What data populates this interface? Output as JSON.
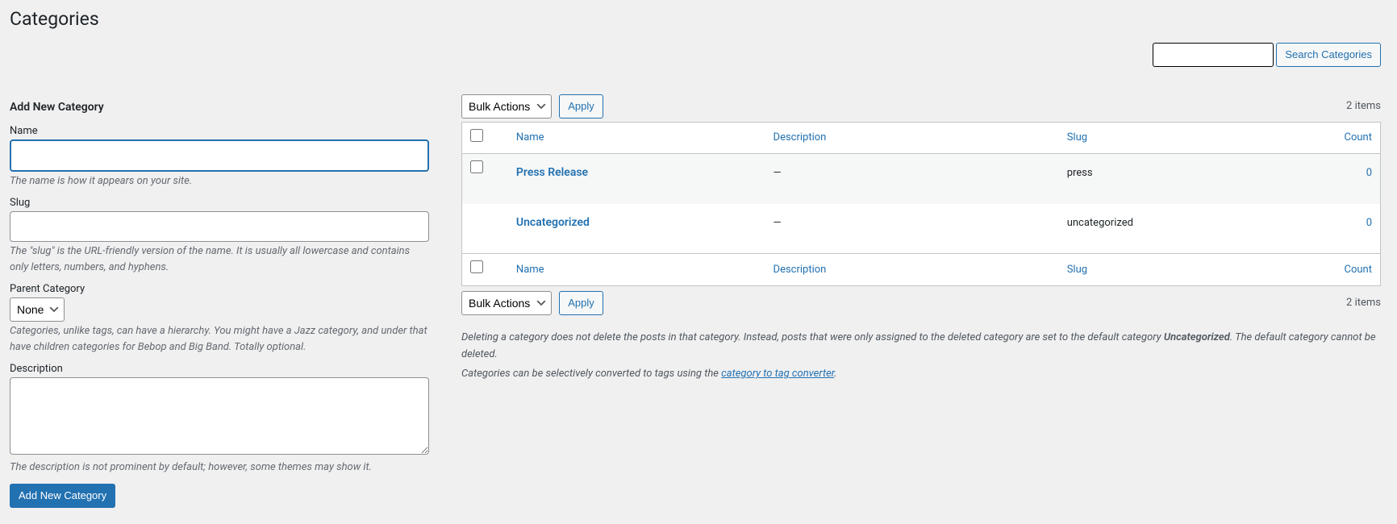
{
  "page_title": "Categories",
  "search": {
    "button": "Search Categories"
  },
  "form": {
    "heading": "Add New Category",
    "name_label": "Name",
    "name_help": "The name is how it appears on your site.",
    "slug_label": "Slug",
    "slug_help": "The \"slug\" is the URL-friendly version of the name. It is usually all lowercase and contains only letters, numbers, and hyphens.",
    "parent_label": "Parent Category",
    "parent_selected": "None",
    "parent_help": "Categories, unlike tags, can have a hierarchy. You might have a Jazz category, and under that have children categories for Bebop and Big Band. Totally optional.",
    "desc_label": "Description",
    "desc_help": "The description is not prominent by default; however, some themes may show it.",
    "submit": "Add New Category"
  },
  "list": {
    "bulk_actions": "Bulk Actions",
    "apply": "Apply",
    "item_count": "2 items",
    "columns": {
      "name": "Name",
      "description": "Description",
      "slug": "Slug",
      "count": "Count"
    },
    "rows": [
      {
        "name": "Press Release",
        "description": "—",
        "slug": "press",
        "count": "0"
      },
      {
        "name": "Uncategorized",
        "description": "—",
        "slug": "uncategorized",
        "count": "0"
      }
    ],
    "note1_pre": "Deleting a category does not delete the posts in that category. Instead, posts that were only assigned to the deleted category are set to the default category ",
    "note1_strong": "Uncategorized",
    "note1_post": ". The default category cannot be deleted.",
    "note2_pre": "Categories can be selectively converted to tags using the ",
    "note2_link": "category to tag converter",
    "note2_post": "."
  }
}
